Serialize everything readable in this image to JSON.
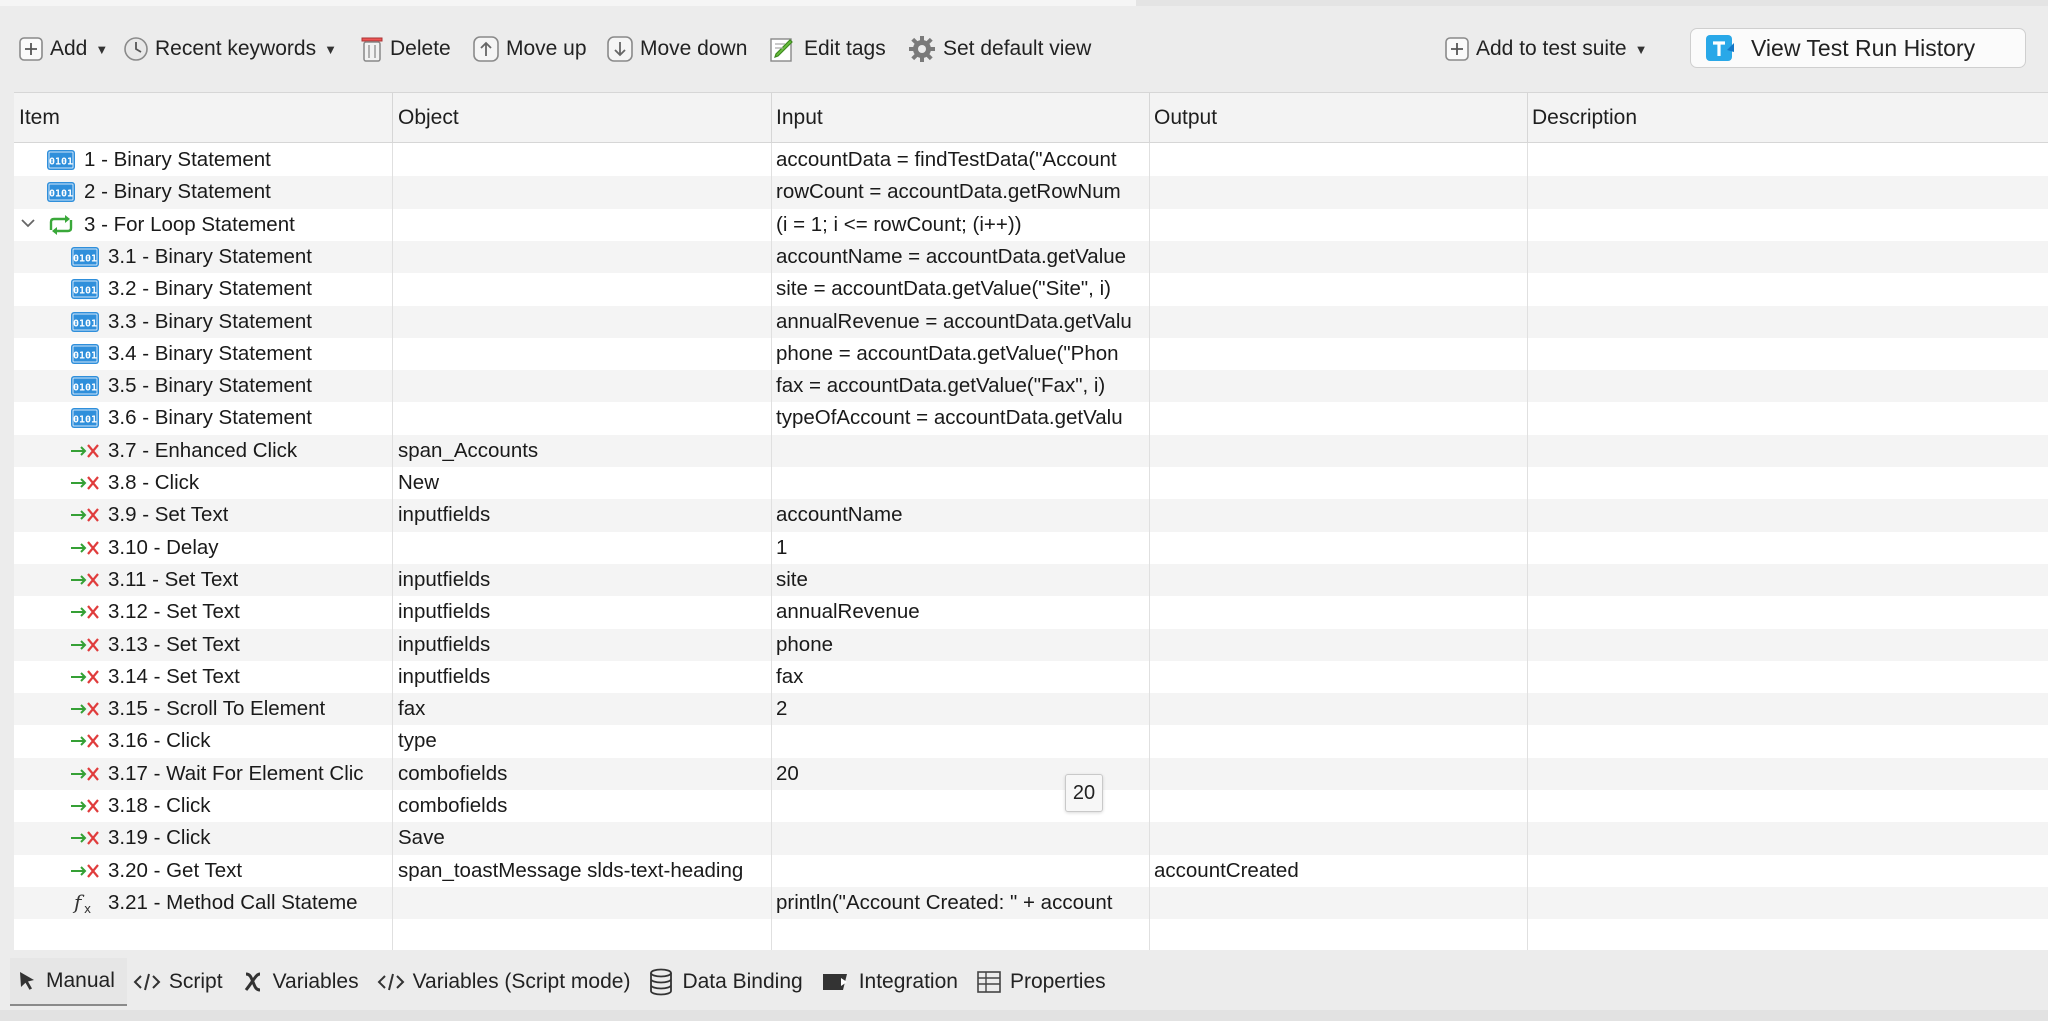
{
  "toolbar": {
    "add": "Add",
    "recent_keywords": "Recent keywords",
    "delete": "Delete",
    "move_up": "Move up",
    "move_down": "Move down",
    "edit_tags": "Edit tags",
    "set_default_view": "Set default view",
    "add_to_test_suite": "Add to test suite",
    "view_test_run_history": "View Test Run History"
  },
  "table": {
    "columns": [
      "Item",
      "Object",
      "Input",
      "Output",
      "Description"
    ],
    "rows": [
      {
        "item": "1 - Binary Statement",
        "object": "",
        "input": "accountData = findTestData(\"Account",
        "output": "",
        "description": ""
      },
      {
        "item": "2 - Binary Statement",
        "object": "",
        "input": "rowCount = accountData.getRowNum",
        "output": "",
        "description": ""
      },
      {
        "item": "3 - For Loop Statement",
        "object": "",
        "input": "(i = 1; i <= rowCount; (i++))",
        "output": "",
        "description": ""
      },
      {
        "item": "3.1 - Binary Statement",
        "object": "",
        "input": "accountName = accountData.getValue",
        "output": "",
        "description": ""
      },
      {
        "item": "3.2 - Binary Statement",
        "object": "",
        "input": "site = accountData.getValue(\"Site\", i)",
        "output": "",
        "description": ""
      },
      {
        "item": "3.3 - Binary Statement",
        "object": "",
        "input": "annualRevenue = accountData.getValu",
        "output": "",
        "description": ""
      },
      {
        "item": "3.4 - Binary Statement",
        "object": "",
        "input": "phone = accountData.getValue(\"Phon",
        "output": "",
        "description": ""
      },
      {
        "item": "3.5 - Binary Statement",
        "object": "",
        "input": "fax = accountData.getValue(\"Fax\", i)",
        "output": "",
        "description": ""
      },
      {
        "item": "3.6 - Binary Statement",
        "object": "",
        "input": "typeOfAccount = accountData.getValu",
        "output": "",
        "description": ""
      },
      {
        "item": "3.7 - Enhanced Click",
        "object": "span_Accounts",
        "input": "",
        "output": "",
        "description": ""
      },
      {
        "item": "3.8 - Click",
        "object": "New",
        "input": "",
        "output": "",
        "description": ""
      },
      {
        "item": "3.9 - Set Text",
        "object": "inputfields",
        "input": "accountName",
        "output": "",
        "description": ""
      },
      {
        "item": "3.10 - Delay",
        "object": "",
        "input": "1",
        "output": "",
        "description": ""
      },
      {
        "item": "3.11 - Set Text",
        "object": "inputfields",
        "input": "site",
        "output": "",
        "description": ""
      },
      {
        "item": "3.12 - Set Text",
        "object": "inputfields",
        "input": "annualRevenue",
        "output": "",
        "description": ""
      },
      {
        "item": "3.13 - Set Text",
        "object": "inputfields",
        "input": "phone",
        "output": "",
        "description": ""
      },
      {
        "item": "3.14 - Set Text",
        "object": "inputfields",
        "input": "fax",
        "output": "",
        "description": ""
      },
      {
        "item": "3.15 - Scroll To Element",
        "object": "fax",
        "input": "2",
        "output": "",
        "description": ""
      },
      {
        "item": "3.16 - Click",
        "object": "type",
        "input": "",
        "output": "",
        "description": ""
      },
      {
        "item": "3.17 - Wait For Element Clic",
        "object": "combofields",
        "input": "20",
        "output": "",
        "description": ""
      },
      {
        "item": "3.18 - Click",
        "object": "combofields",
        "input": "",
        "output": "",
        "description": ""
      },
      {
        "item": "3.19 - Click",
        "object": "Save",
        "input": "",
        "output": "",
        "description": ""
      },
      {
        "item": "3.20 - Get Text",
        "object": "span_toastMessage slds-text-heading",
        "input": "",
        "output": "accountCreated",
        "description": ""
      },
      {
        "item": "3.21 - Method Call Stateme",
        "object": "",
        "input": "println(\"Account Created: \" + account",
        "output": "",
        "description": ""
      }
    ]
  },
  "tooltip": "20",
  "bottom_tabs": [
    "Manual",
    "Script",
    "Variables",
    "Variables (Script mode)",
    "Data Binding",
    "Integration",
    "Properties"
  ],
  "colors": {
    "binary_icon": "#2f8fdb",
    "loop_icon": "#3aa83a",
    "keyword_arrow": "#35a035",
    "keyword_x": "#e03c3c"
  }
}
